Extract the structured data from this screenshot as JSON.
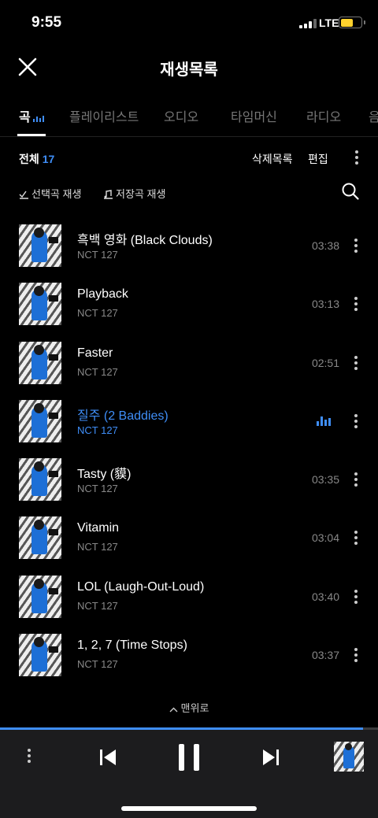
{
  "status_bar": {
    "time": "9:55",
    "network": "LTE"
  },
  "header": {
    "title": "재생목록",
    "close_icon": "close-icon"
  },
  "tabs": [
    {
      "label": "곡",
      "active": true
    },
    {
      "label": "플레이리스트",
      "active": false
    },
    {
      "label": "오디오",
      "active": false
    },
    {
      "label": "타임머신",
      "active": false
    },
    {
      "label": "라디오",
      "active": false
    },
    {
      "label": "음",
      "active": false
    }
  ],
  "toolbar": {
    "total_label": "전체",
    "total_count": "17",
    "delete_list": "삭제목록",
    "edit": "편집"
  },
  "play_options": {
    "play_selected": "선택곡 재생",
    "play_saved": "저장곡 재생"
  },
  "songs": [
    {
      "title": "흑백 영화 (Black Clouds)",
      "artist": "NCT 127",
      "duration": "03:38",
      "playing": false
    },
    {
      "title": "Playback",
      "artist": "NCT 127",
      "duration": "03:13",
      "playing": false
    },
    {
      "title": "Faster",
      "artist": "NCT 127",
      "duration": "02:51",
      "playing": false
    },
    {
      "title": "질주 (2 Baddies)",
      "artist": "NCT 127",
      "duration": "",
      "playing": true
    },
    {
      "title": "Tasty (貘)",
      "artist": "NCT 127",
      "duration": "03:35",
      "playing": false
    },
    {
      "title": "Vitamin",
      "artist": "NCT 127",
      "duration": "03:04",
      "playing": false
    },
    {
      "title": "LOL (Laugh-Out-Loud)",
      "artist": "NCT 127",
      "duration": "03:40",
      "playing": false
    },
    {
      "title": "1, 2, 7 (Time Stops)",
      "artist": "NCT 127",
      "duration": "03:37",
      "playing": false
    }
  ],
  "scroll_to_top": "맨위로",
  "player": {
    "progress": 0.96
  },
  "colors": {
    "accent": "#3f8ef7",
    "background": "#000000",
    "muted_text": "#888888",
    "battery": "#ffd22e"
  }
}
